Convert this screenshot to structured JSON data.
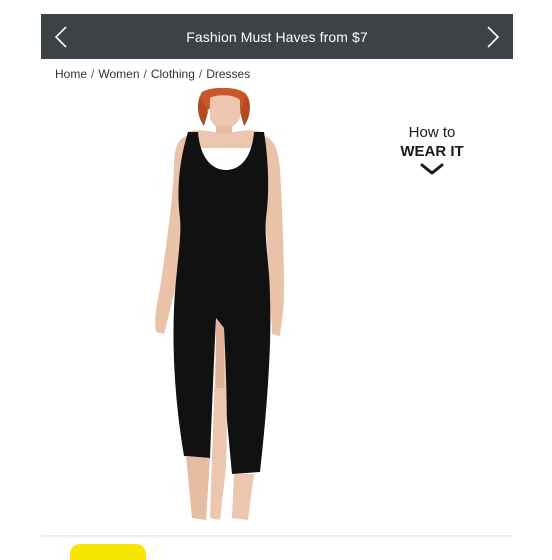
{
  "promo": {
    "title": "Fashion Must Haves from $7",
    "prev_icon": "chevron-left-icon",
    "next_icon": "chevron-right-icon"
  },
  "breadcrumb": {
    "items": [
      "Home",
      "Women",
      "Clothing",
      "Dresses"
    ],
    "separator": "/"
  },
  "product": {
    "image_icon": "product-photo-black-midi-dress"
  },
  "how_to": {
    "line1": "How to",
    "line2": "WEAR IT",
    "icon": "chevron-down-icon"
  },
  "colors": {
    "promo_bg": "#3c4246",
    "accent_yellow": "#f7e600",
    "dress": "#111111"
  }
}
